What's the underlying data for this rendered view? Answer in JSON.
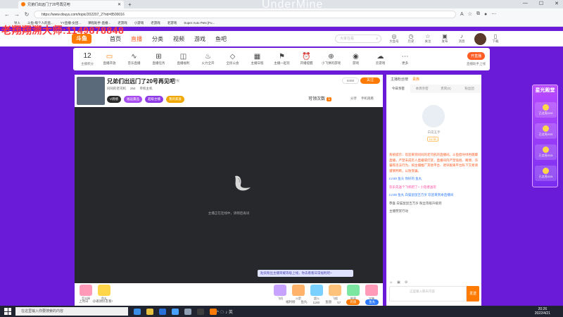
{
  "browser": {
    "tab_title": "兄弟们出远门了20号再见吧",
    "watermark_title": "UnderMine",
    "url": "https://www.douyu.com/topic/202207_2?rid=8500016",
    "bookmarks": [
      "导入",
      "斗鱼-每个人的直...",
      "YY直播-女团...",
      "课程助手-直播...",
      "老游戏",
      "小游戏",
      "老游戏",
      "老游戏",
      "Super Auto Pets [Fu..."
    ]
  },
  "overlay_text": "老翔翔溯大师:1149878848",
  "site": {
    "logo": "斗鱼",
    "nav": [
      "首页",
      "直播",
      "分类",
      "视频",
      "游戏",
      "鱼吧"
    ],
    "nav_active_index": 1,
    "search_placeholder": "大家在看",
    "header_icons": [
      {
        "icon": "tiktok-icon",
        "label": "大鱼号"
      },
      {
        "icon": "clock-icon",
        "label": "历史"
      },
      {
        "icon": "star-icon",
        "label": "关注"
      },
      {
        "icon": "video-icon",
        "label": "发布"
      },
      {
        "icon": "bell-icon",
        "label": "消息"
      },
      {
        "icon": "gift-icon",
        "label": "客户"
      },
      {
        "icon": "phone-icon",
        "label": "下载"
      }
    ]
  },
  "category_bar": {
    "count": "12",
    "count_label": "主播积分",
    "items": [
      {
        "icon": "tv-icon",
        "label": "直播开放"
      },
      {
        "icon": "wave-icon",
        "label": "音乐直播"
      },
      {
        "icon": "gamepad-icon",
        "label": "直播任务"
      },
      {
        "icon": "gift-icon",
        "label": "直播福利"
      },
      {
        "icon": "fire-icon",
        "label": "火力全开"
      },
      {
        "icon": "shield-icon",
        "label": "全民公会"
      },
      {
        "icon": "calendar-icon",
        "label": "主播日程"
      },
      {
        "icon": "flag-icon",
        "label": "主播一起玩"
      },
      {
        "icon": "alarm-icon",
        "label": "开播提醒"
      },
      {
        "icon": "controller-icon",
        "label": "小飞弹的游戏"
      },
      {
        "icon": "gamepad-icon",
        "label": "游戏"
      },
      {
        "icon": "cloud-icon",
        "label": "云游戏"
      },
      {
        "icon": "more-icon",
        "label": "更多"
      }
    ],
    "right_button": "开直播",
    "right_label": "直播助手上线"
  },
  "room": {
    "title": "兄弟们出远门了20号再见吧",
    "report": "举报",
    "meta": [
      "同同的老司机",
      "264",
      "单机主机"
    ],
    "tags": [
      {
        "text": "V周榜",
        "color": "#2b2b2b"
      },
      {
        "text": "福运嘉品",
        "color": "#a74cf0"
      },
      {
        "text": "超级主播",
        "color": "#8e3be6"
      },
      {
        "text": "我的家族",
        "color": "#f0a800"
      }
    ],
    "hot_value": "8459",
    "follow_label": "关注",
    "task_label": "可领次数",
    "task_count": "1",
    "share_label": "分享",
    "phone_watch_label": "手机观看",
    "video_message": "主播正在连线中，请稍后再试",
    "notice": "贴贡粉丝主播荣耀等级上线，你去看看日常福利吧~",
    "gifts": [
      {
        "label": "荧光棒",
        "color": "#ff9ab8"
      },
      {
        "label": "鱼丸",
        "color": "#ffd54a"
      },
      {
        "label": "飞机",
        "color": "#c7a3ff"
      },
      {
        "label": "火箭",
        "color": "#ffb36a"
      },
      {
        "label": "超火",
        "color": "#7ad0ff"
      },
      {
        "label": "飞船",
        "color": "#ffc27a"
      },
      {
        "label": "能量",
        "color": "#7ce7a0"
      },
      {
        "label": "宝箱",
        "color": "#ff9ab8"
      }
    ],
    "bottom_left": [
      "上周日",
      "@邀请好友看!"
    ],
    "bottom_right": [
      "福利榜",
      "鱼丸",
      "1180",
      "鱼翅",
      "57"
    ],
    "charge_label": "充值",
    "fishball_label": "鱼丸"
  },
  "right_panel": {
    "top_a": "主播粉丝榜",
    "top_b": "贵族",
    "tabs": [
      "今日亲密",
      "本周亲密",
      "贵宾(0)",
      "粉丝团"
    ],
    "rank_empty_label": "白菜五手",
    "rank_lv": "LV.30",
    "chat": [
      {
        "type": "sys",
        "text": "系统提示：欢迎来到同同的老司机的直播间。斗鱼倡导绿色健康直播，严禁未成年人直播或打赏，直播间内严禁低俗、赌博、诈骗等违法行为，如主播推广其他平台、诱导脱离平台私下交易请谨慎判断，以防受骗。"
      },
      {
        "type": "name",
        "text": "LV.80 鱼头 你好的 鱼丸"
      },
      {
        "type": "pink",
        "text": "欢乐先送个飞机吧了~ 小陪者送玩"
      },
      {
        "type": "name",
        "text": "LV.85 鱼丸 白猫鼠鼠吉万岁 欢迎来到本直播间"
      },
      {
        "type": "plain",
        "text": "恭喜 白猫鼠鼠吉万岁 粉丝等级升级到"
      },
      {
        "type": "plain",
        "text": "主播赞赏行动"
      }
    ],
    "input_placeholder": "这里输入聊天内容",
    "send_label": "发送"
  },
  "promo": {
    "title": "星光殿堂",
    "items": [
      "已点亮0/15",
      "已点亮0/15",
      "已点亮0/15",
      "已点亮0/15"
    ]
  },
  "taskbar": {
    "search_placeholder": "在这里输入你要搜索的内容",
    "time": "20:26",
    "date": "2022/4/21",
    "apps": [
      "#3a8ee6",
      "#e8c040",
      "#2a6fd8",
      "#4aa0ff",
      "#8fa0b5",
      "#3d3d3d",
      "#ff7a00"
    ]
  }
}
